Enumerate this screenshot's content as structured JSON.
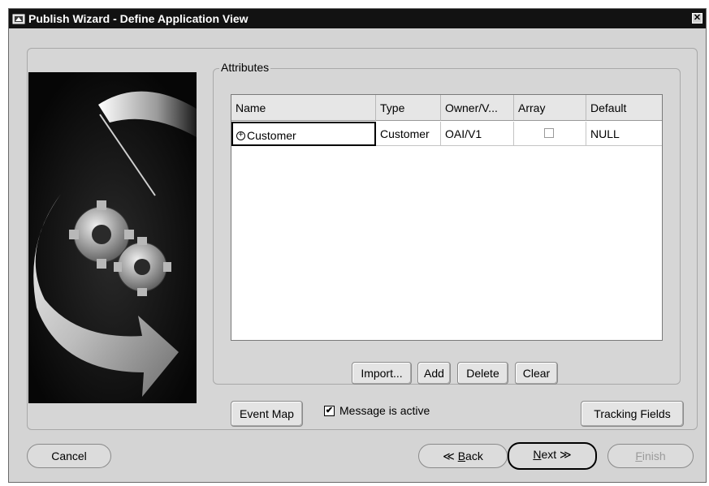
{
  "window": {
    "title": "Publish Wizard - Define Application View",
    "close_glyph": "✕"
  },
  "attributes": {
    "group_label": "Attributes",
    "columns": [
      "Name",
      "Type",
      "Owner/V...",
      "Array",
      "Default"
    ],
    "rows": [
      {
        "name": "Customer",
        "expand_glyph": "+",
        "type": "Customer",
        "owner": "OAI/V1",
        "array_checked": false,
        "default": "NULL"
      }
    ]
  },
  "table_buttons": {
    "import": "Import...",
    "add": "Add",
    "delete": "Delete",
    "clear": "Clear"
  },
  "options": {
    "event_map": "Event Map",
    "message_active_label": "Message is active",
    "message_active_checked": true,
    "checkmark": "✔",
    "tracking_fields": "Tracking Fields"
  },
  "nav": {
    "cancel": "Cancel",
    "back_arrow": "≪",
    "back_mnemonic": "B",
    "back_rest": "ack",
    "next_mnemonic": "N",
    "next_rest": "ext",
    "next_arrow": "≫",
    "finish_mnemonic": "F",
    "finish_rest": "inish",
    "finish_disabled": true
  },
  "illustration": "wizard-graphic-gears-arrow-pen"
}
